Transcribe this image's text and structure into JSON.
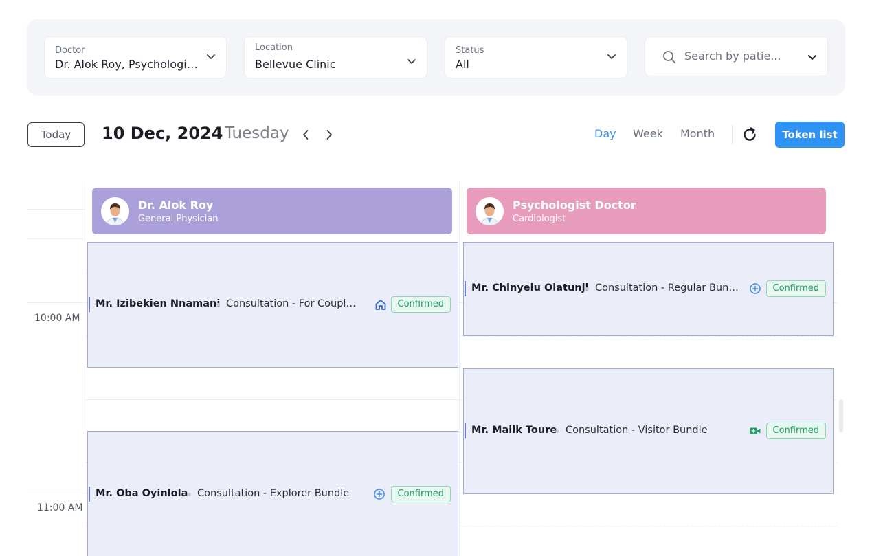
{
  "filters": {
    "doctor": {
      "label": "Doctor",
      "value": "Dr. Alok Roy, Psychologist Doctor"
    },
    "location": {
      "label": "Location",
      "value": "Bellevue Clinic"
    },
    "status": {
      "label": "Status",
      "value": "All"
    },
    "search": {
      "placeholder": "Search by patie..."
    }
  },
  "toolbar": {
    "today_label": "Today",
    "date": "10 Dec, 2024",
    "weekday": "Tuesday",
    "views": [
      "Day",
      "Week",
      "Month"
    ],
    "active_view": "Day",
    "token_label": "Token list"
  },
  "times": [
    "10:00 AM",
    "11:00 AM"
  ],
  "doctors": [
    {
      "name": "Dr. Alok Roy",
      "specialty": "General Physician",
      "color": "#aba0da"
    },
    {
      "name": "Psychologist Doctor",
      "specialty": "Cardiologist",
      "color": "#e89cbb"
    }
  ],
  "appointments": [
    {
      "patient": "Mr. Izibekien Nnamani",
      "service": "Consultation - For Couples Bundle",
      "mode_icon": "clinic-icon",
      "status": "Confirmed"
    },
    {
      "patient": "Mr. Oba Oyinlola",
      "service": "Consultation - Explorer Bundle",
      "mode_icon": "add-circle-icon",
      "status": "Confirmed"
    },
    {
      "patient": "Mr. Chinyelu Olatunji",
      "service": "Consultation - Regular Bundle",
      "mode_icon": "add-circle-icon",
      "status": "Confirmed"
    },
    {
      "patient": "Mr. Malik Toure",
      "service": "Consultation - Visitor Bundle",
      "mode_icon": "video-icon",
      "status": "Confirmed"
    }
  ],
  "colors": {
    "accent": "#2f93f5",
    "confirmed": "#1f9a62",
    "appointment_bg": "#ebedf8"
  }
}
